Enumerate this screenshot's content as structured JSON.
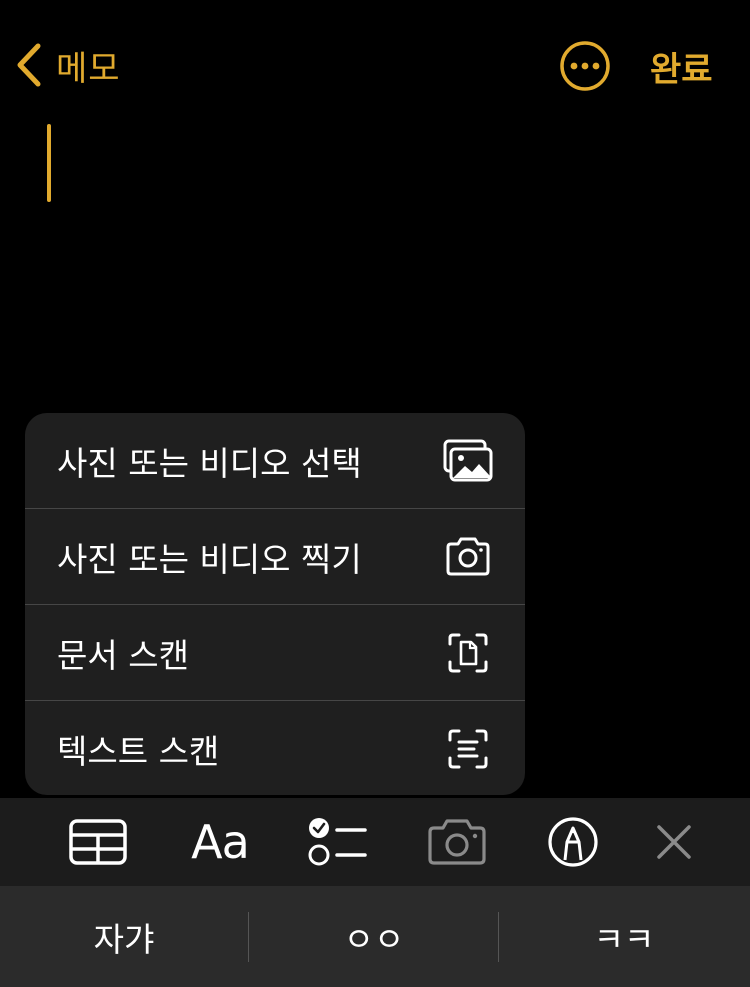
{
  "nav": {
    "back_label": "메모",
    "done_label": "완료"
  },
  "menu": {
    "items": [
      {
        "label": "사진 또는 비디오 선택",
        "icon": "photo-library-icon"
      },
      {
        "label": "사진 또는 비디오 찍기",
        "icon": "camera-icon"
      },
      {
        "label": "문서 스캔",
        "icon": "doc-scan-icon"
      },
      {
        "label": "텍스트 스캔",
        "icon": "text-scan-icon"
      }
    ]
  },
  "toolbar": {
    "format_label": "Aa",
    "icons": [
      "table-icon",
      "format-icon",
      "checklist-icon",
      "camera-icon",
      "markup-icon",
      "close-icon"
    ]
  },
  "suggestions": [
    "자갸",
    "ㅇㅇ",
    "ㅋㅋ"
  ],
  "colors": {
    "accent": "#e1aa2e",
    "background": "#000000",
    "menu_bg": "#1f1f1f",
    "toolbar_bg": "#1c1c1c",
    "keyboard_bg": "#2b2b2b"
  }
}
